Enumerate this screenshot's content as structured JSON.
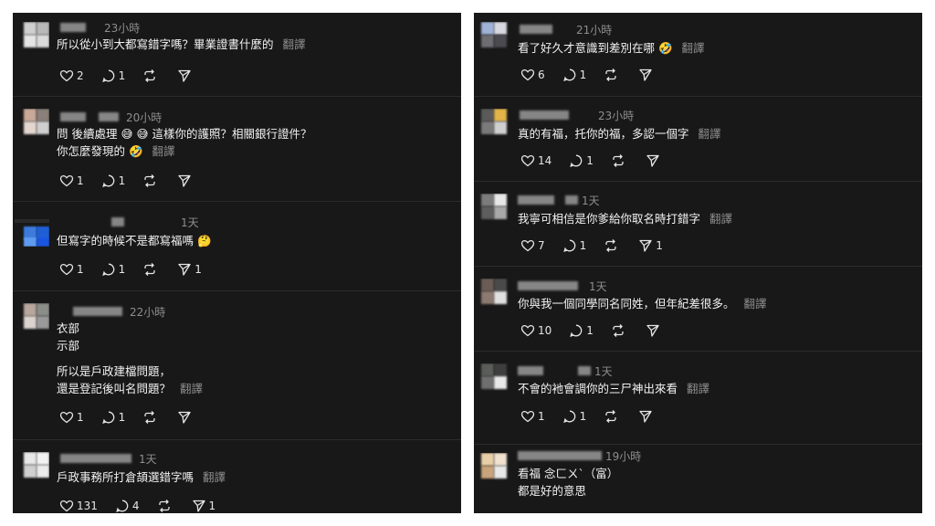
{
  "translate_label": "翻譯",
  "left": [
    {
      "time": "23小時",
      "lines": [
        "所以從小到大都寫錯字嗎？畢業證書什麼的"
      ],
      "likes": "2",
      "replies": "1",
      "reposts": "",
      "shares": ""
    },
    {
      "time": "20小時",
      "lines": [
        "問 後續處理 😅 😅 這樣你的護照？相關銀行證件？",
        "你怎麼發現的 🤣"
      ],
      "likes": "1",
      "replies": "1",
      "reposts": "",
      "shares": ""
    },
    {
      "time": "1天",
      "lines": [
        "但寫字的時候不是都寫福嗎 🤔"
      ],
      "likes": "1",
      "replies": "1",
      "reposts": "",
      "shares": "1"
    },
    {
      "time": "22小時",
      "lines": [
        "衣部",
        "示部",
        "",
        "所以是戶政建檔問題，",
        "還是登記後叫名問題？"
      ],
      "likes": "1",
      "replies": "1",
      "reposts": "",
      "shares": ""
    },
    {
      "time": "1天",
      "lines": [
        "戶政事務所打倉頡選錯字嗎"
      ],
      "likes": "131",
      "replies": "4",
      "reposts": "",
      "shares": "1"
    }
  ],
  "right": [
    {
      "time": "21小時",
      "lines": [
        "看了好久才意識到差別在哪 🤣"
      ],
      "likes": "6",
      "replies": "1",
      "reposts": "",
      "shares": ""
    },
    {
      "time": "23小時",
      "lines": [
        "真的有福，托你的福，多認一個字"
      ],
      "likes": "14",
      "replies": "1",
      "reposts": "",
      "shares": ""
    },
    {
      "time": "1天",
      "lines": [
        "我寧可相信是你爹給你取名時打錯字"
      ],
      "likes": "7",
      "replies": "1",
      "reposts": "",
      "shares": "1"
    },
    {
      "time": "1天",
      "lines": [
        "你與我一個同學同名同姓，但年紀差很多。"
      ],
      "likes": "10",
      "replies": "1",
      "reposts": "",
      "shares": ""
    },
    {
      "time": "1天",
      "lines": [
        "不會的衪會調你的三尸神出來看"
      ],
      "likes": "1",
      "replies": "1",
      "reposts": "",
      "shares": ""
    },
    {
      "time": "19小時",
      "lines": [
        "看福 念ㄈㄨˋ（富）",
        "都是好的意思"
      ],
      "likes": "",
      "replies": "",
      "reposts": "",
      "shares": ""
    }
  ],
  "colors": {
    "panel_bg": "#181818",
    "text": "#f2f2f2",
    "muted": "#8e8e8e",
    "divider": "#2c2c2c"
  },
  "icons": [
    "heart-icon",
    "reply-icon",
    "repost-icon",
    "share-icon"
  ]
}
